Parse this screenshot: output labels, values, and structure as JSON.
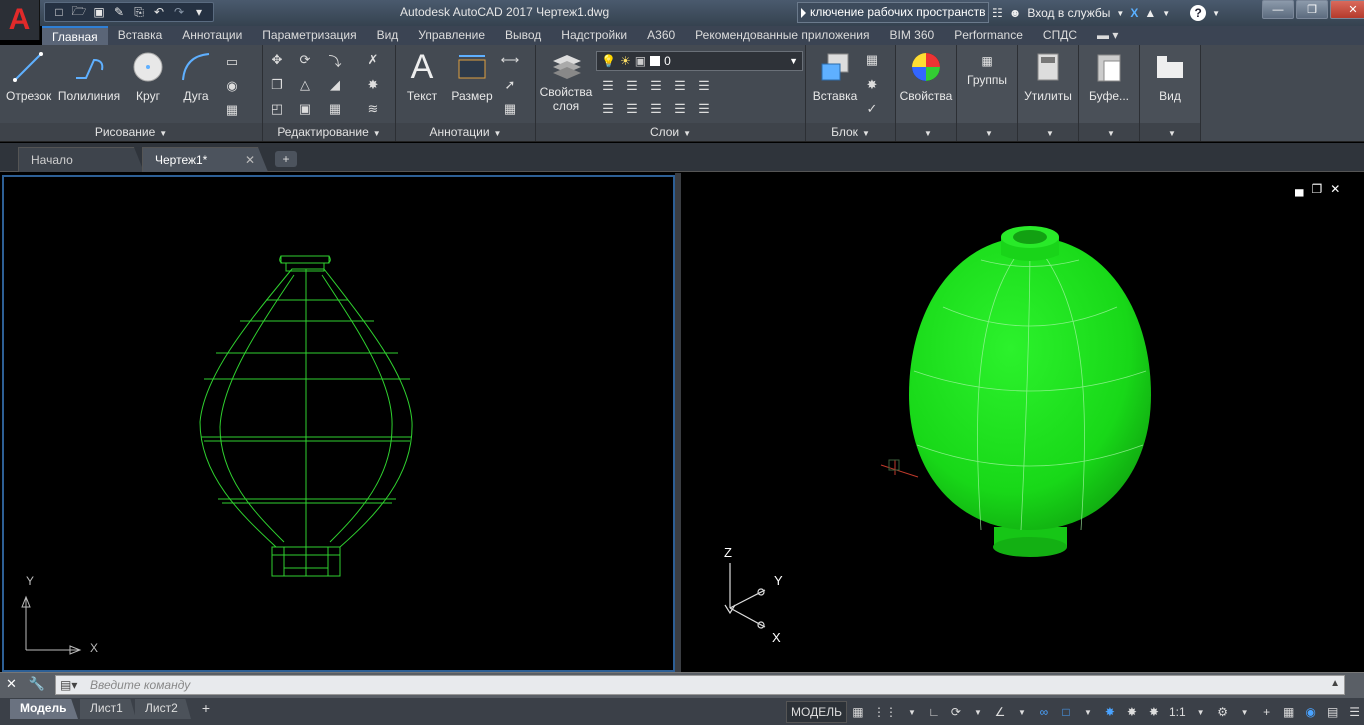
{
  "app": {
    "title": "Autodesk AutoCAD 2017    Чертеж1.dwg",
    "logo": "A",
    "search_text": "ключение рабочих пространств",
    "sign_in": "Вход в службы",
    "help": "?"
  },
  "quick_access": [
    "new-icon",
    "open-icon",
    "save-icon",
    "saveas-icon",
    "plot-icon",
    "undo-icon",
    "redo-icon",
    "dropdown-icon"
  ],
  "ribbon_tabs": [
    "Главная",
    "Вставка",
    "Аннотации",
    "Параметризация",
    "Вид",
    "Управление",
    "Вывод",
    "Надстройки",
    "A360",
    "Рекомендованные приложения",
    "BIM 360",
    "Performance",
    "СПДС"
  ],
  "active_tab": "Главная",
  "panels": {
    "draw": {
      "title": "Рисование",
      "buttons": [
        "Отрезок",
        "Полилиния",
        "Круг",
        "Дуга"
      ]
    },
    "modify": {
      "title": "Редактирование"
    },
    "annotation": {
      "title": "Аннотации",
      "buttons": [
        "Текст",
        "Размер"
      ]
    },
    "layers": {
      "title": "Слои",
      "button_line1": "Свойства",
      "button_line2": "слоя",
      "current_layer": "0"
    },
    "block": {
      "title": "Блок",
      "buttons": [
        "Вставка"
      ]
    },
    "properties": {
      "label": "Свойства"
    },
    "groups": {
      "label": "Группы"
    },
    "utilities": {
      "label": "Утилиты"
    },
    "clipboard": {
      "label": "Буфе..."
    },
    "view": {
      "label": "Вид"
    }
  },
  "file_tabs": [
    "Начало",
    "Чертеж1*"
  ],
  "viewport_left": {
    "ucs_y": "Y",
    "ucs_x": "X"
  },
  "viewport_right": {
    "axis_z": "Z",
    "axis_y": "Y",
    "axis_x": "X"
  },
  "command": {
    "placeholder": "Введите команду"
  },
  "layout_tabs": [
    "Модель",
    "Лист1",
    "Лист2"
  ],
  "status": {
    "model": "МОДЕЛЬ",
    "scale": "1:1"
  },
  "colors": {
    "wireframe": "#2fd12f",
    "solid": "#19e019",
    "ribbon_bg": "#444a52",
    "accent": "#2e7fd6"
  }
}
